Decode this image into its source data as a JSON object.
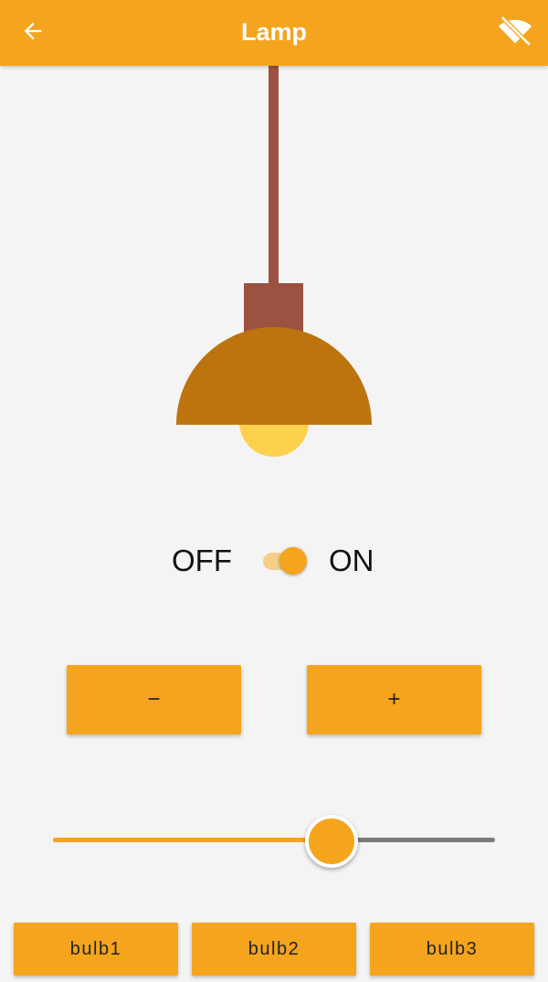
{
  "app_bar": {
    "title": "Lamp",
    "back_icon": "arrow-back-icon",
    "wifi_icon": "wifi-off-icon",
    "color": "#f5a41d"
  },
  "lamp": {
    "cord_color": "#9b5240",
    "shade_color": "#bd730e",
    "bulb_color": "#fcd14d"
  },
  "power": {
    "off_label": "OFF",
    "on_label": "ON",
    "state": "on"
  },
  "controls": {
    "decrease_label": "−",
    "increase_label": "+"
  },
  "brightness": {
    "value": 0.63
  },
  "bulbs": [
    {
      "label": "bulb1"
    },
    {
      "label": "bulb2"
    },
    {
      "label": "bulb3"
    }
  ]
}
